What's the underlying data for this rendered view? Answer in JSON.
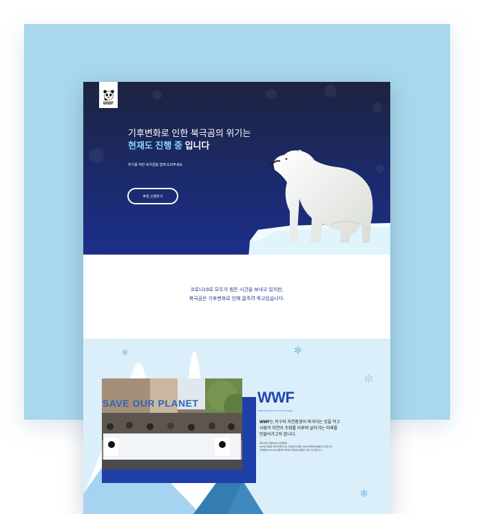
{
  "hero": {
    "logo_text": "WWF",
    "headline_line1": "기후변화로 인한 북극곰의 위기는",
    "headline_highlight": "현재도 진행 중",
    "headline_rest": " 입니다",
    "subtext": "위기를 처한 북극곰을 함께 도와주세요",
    "cta_label": "후원 신청하기"
  },
  "intro": {
    "line1": "코로나19로 모두가 힘든 시간을 보내고 있지만,",
    "line2": "북극곰은 기후변화로 인해 굶주려 죽고있습니다."
  },
  "about": {
    "photo_banner": "SAVE OUR PLANET",
    "title": "WWF",
    "tagline": "(WORLD WIDE FUND FOR NATURE)",
    "desc_lead": "WWF",
    "desc_line1": "는 지구의 자연환경이 파괴되는 것을 막고",
    "desc_line2": "사람과 자연이 조화를 이루며 살아가는 미래를",
    "desc_line3": "만들어가고자 합니다.",
    "fine_line1": "세계 자연 기금(WWF) 한국본부",
    "fine_line2": "1961년 설립된 세계 최대의 민간 자연보전 단체로 100여 개국에서 활동하고 있습니다.",
    "fine_line3": "한국본부는 2014년 설립되어 국내외 자연보전 활동을 이어가고 있습니다."
  },
  "colors": {
    "panel": "#a9d8ec",
    "hero_top": "#1d2340",
    "hero_bottom": "#1d2f8a",
    "accent": "#86d3ff",
    "brand_blue": "#1f46ad"
  }
}
